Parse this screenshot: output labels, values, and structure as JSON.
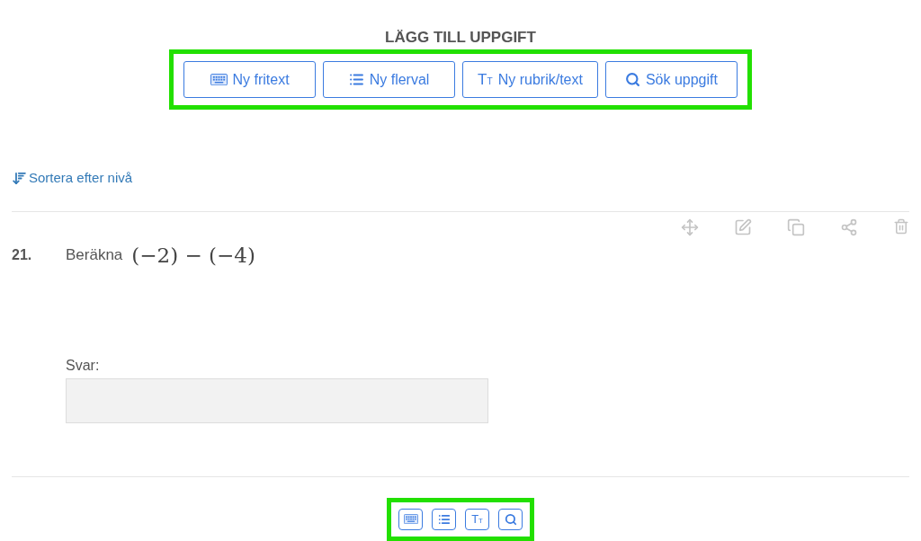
{
  "heading": "LÄGG TILL UPPGIFT",
  "add_buttons": [
    {
      "kind": "keyboard",
      "label": "Ny fritext"
    },
    {
      "kind": "list",
      "label": "Ny flerval"
    },
    {
      "kind": "text",
      "glyph": "T",
      "glyph_small": "T",
      "label": "Ny rubrik/text"
    },
    {
      "kind": "search",
      "label": "Sök uppgift"
    }
  ],
  "sort_link": "Sortera efter nivå",
  "question": {
    "number": "21.",
    "text": "Beräkna",
    "math": "(−2) − (−4)",
    "answer_label": "Svar:"
  },
  "bottom_buttons": [
    {
      "kind": "keyboard"
    },
    {
      "kind": "list"
    },
    {
      "kind": "text",
      "glyph": "T",
      "glyph_small": "T"
    },
    {
      "kind": "search"
    }
  ]
}
